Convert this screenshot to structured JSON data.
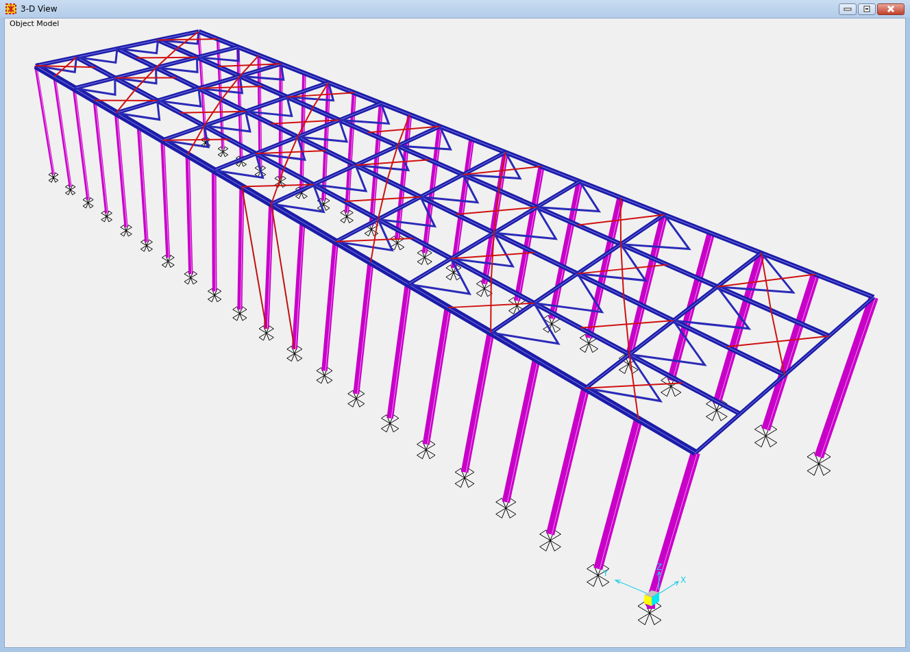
{
  "window": {
    "title": "3-D View"
  },
  "view": {
    "label": "Object Model",
    "axes": [
      {
        "label": "X"
      },
      {
        "label": "Y"
      },
      {
        "label": "Z"
      }
    ]
  }
}
